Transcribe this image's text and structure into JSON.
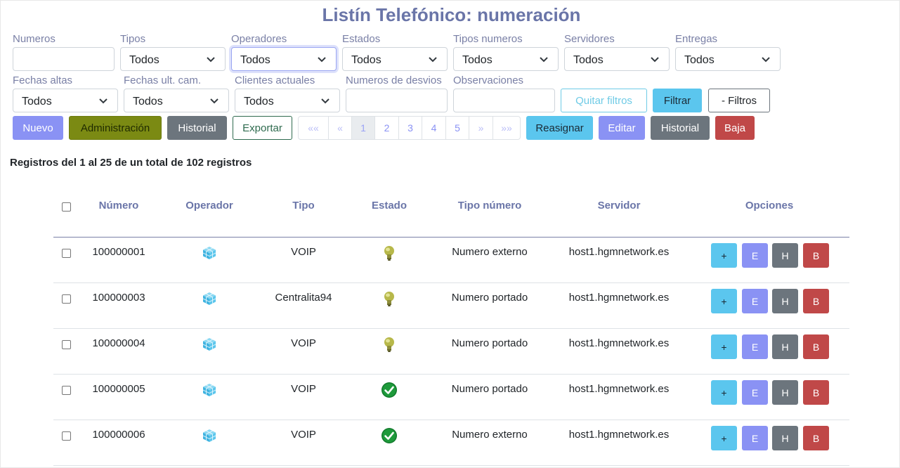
{
  "page_title": "Listín Telefónico: numeración",
  "filters": {
    "numeros": {
      "label": "Numeros",
      "value": ""
    },
    "tipos": {
      "label": "Tipos",
      "value": "Todos"
    },
    "operadores": {
      "label": "Operadores",
      "value": "Todos"
    },
    "estados": {
      "label": "Estados",
      "value": "Todos"
    },
    "tipos_numeros": {
      "label": "Tipos numeros",
      "value": "Todos"
    },
    "servidores": {
      "label": "Servidores",
      "value": "Todos"
    },
    "entregas": {
      "label": "Entregas",
      "value": "Todos"
    },
    "fechas_altas": {
      "label": "Fechas altas",
      "value": "Todos"
    },
    "fechas_ult_cam": {
      "label": "Fechas ult. cam.",
      "value": "Todos"
    },
    "clientes_actuales": {
      "label": "Clientes actuales",
      "value": "Todos"
    },
    "numeros_desvios": {
      "label": "Numeros de desvios",
      "value": ""
    },
    "observaciones": {
      "label": "Observaciones",
      "value": ""
    },
    "quitar_filtros": "Quitar filtros",
    "filtrar": "Filtrar",
    "toggle_filtros": "- Filtros"
  },
  "toolbar": {
    "nuevo": "Nuevo",
    "administracion": "Administración",
    "historial": "Historial",
    "exportar": "Exportar",
    "reasignar": "Reasignar",
    "editar": "Editar",
    "historial2": "Historial",
    "baja": "Baja"
  },
  "pagination": {
    "first": "««",
    "prev": "«",
    "pages": [
      "1",
      "2",
      "3",
      "4",
      "5"
    ],
    "next": "»",
    "last": "»»",
    "current": "1"
  },
  "summary": {
    "prefix": "Registros del ",
    "from": "1",
    "mid": " al ",
    "to": "25",
    "mid2": " de un total de ",
    "total": "102",
    "suffix": " registros"
  },
  "table": {
    "headers": {
      "numero": "Número",
      "operador": "Operador",
      "tipo": "Tipo",
      "estado": "Estado",
      "tipo_numero": "Tipo número",
      "servidor": "Servidor",
      "opciones": "Opciones"
    },
    "rows": [
      {
        "numero": "100000001",
        "operador_icon": "operator-cube-icon",
        "tipo": "VOIP",
        "estado_icon": "bulb-icon",
        "tipo_numero": "Numero externo",
        "servidor": "host1.hgmnetwork.es"
      },
      {
        "numero": "100000003",
        "operador_icon": "operator-cube-icon",
        "tipo": "Centralita94",
        "estado_icon": "bulb-icon",
        "tipo_numero": "Numero portado",
        "servidor": "host1.hgmnetwork.es"
      },
      {
        "numero": "100000004",
        "operador_icon": "operator-cube-icon",
        "tipo": "VOIP",
        "estado_icon": "bulb-icon",
        "tipo_numero": "Numero portado",
        "servidor": "host1.hgmnetwork.es"
      },
      {
        "numero": "100000005",
        "operador_icon": "operator-cube-icon",
        "tipo": "VOIP",
        "estado_icon": "check-circle-icon",
        "tipo_numero": "Numero portado",
        "servidor": "host1.hgmnetwork.es"
      },
      {
        "numero": "100000006",
        "operador_icon": "operator-cube-icon",
        "tipo": "VOIP",
        "estado_icon": "check-circle-icon",
        "tipo_numero": "Numero externo",
        "servidor": "host1.hgmnetwork.es"
      }
    ],
    "row_options": {
      "add": "+",
      "edit": "E",
      "history": "H",
      "delete": "B"
    }
  },
  "colors": {
    "title": "#6a75a8",
    "primary": "#8a92f4",
    "info": "#5bc6ee",
    "secondary": "#6c757d",
    "danger": "#c04848",
    "olive": "#7b8a13"
  }
}
